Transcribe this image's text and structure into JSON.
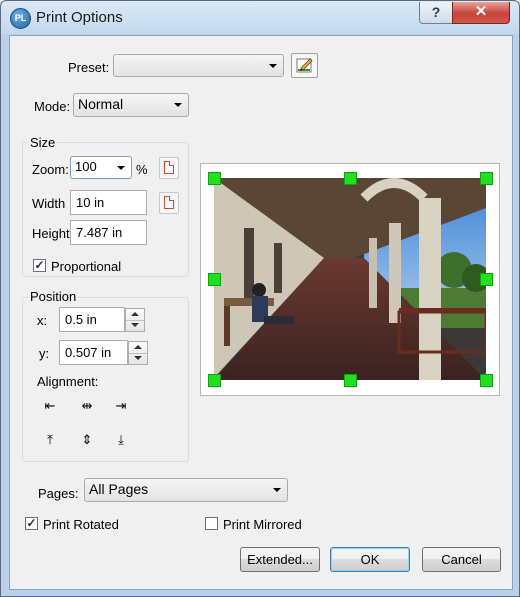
{
  "window": {
    "title": "Print Options",
    "help_glyph": "?",
    "close_glyph": "✕",
    "app_icon": "PL"
  },
  "preset": {
    "label": "Preset:",
    "value": "",
    "edit_icon": "pencil-edit-icon"
  },
  "mode": {
    "label": "Mode:",
    "value": "Normal"
  },
  "size": {
    "group_label": "Size",
    "zoom_label": "Zoom:",
    "zoom_value": "100",
    "zoom_unit": "%",
    "width_label": "Width",
    "width_value": "10 in",
    "height_label": "Height",
    "height_value": "7.487 in",
    "proportional_label": "Proportional",
    "proportional_checked": true
  },
  "position": {
    "group_label": "Position",
    "x_label": "x:",
    "x_value": "0.5 in",
    "y_label": "y:",
    "y_value": "0.507 in",
    "alignment_label": "Alignment:",
    "align_glyphs": {
      "left": "⇤",
      "hcenter": "⇹",
      "right": "⇥",
      "top": "⤒",
      "vcenter": "⇕",
      "bottom": "⤓"
    }
  },
  "pages": {
    "label": "Pages:",
    "value": "All Pages"
  },
  "options": {
    "print_rotated_label": "Print Rotated",
    "print_rotated_checked": true,
    "print_mirrored_label": "Print Mirrored",
    "print_mirrored_checked": false
  },
  "buttons": {
    "extended": "Extended...",
    "ok": "OK",
    "cancel": "Cancel"
  },
  "colors": {
    "handle": "#23e01f",
    "accent": "#3c7fb1"
  }
}
